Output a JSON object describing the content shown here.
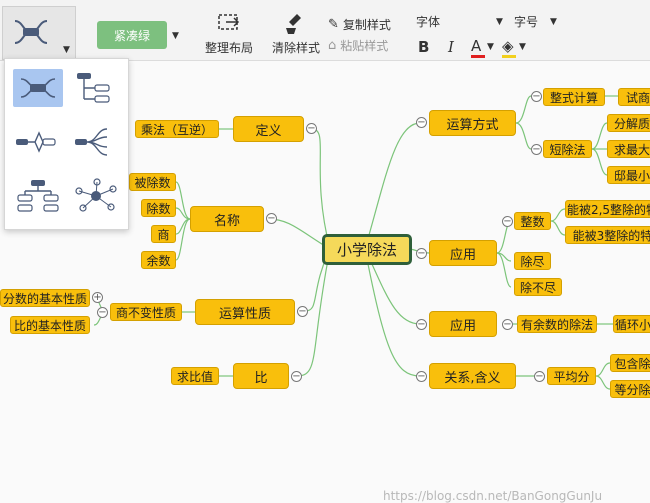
{
  "toolbar": {
    "organize_label": "整理布局",
    "clear_style_label": "清除样式",
    "copy_style_label": "复制样式",
    "paste_style_label": "粘贴样式",
    "theme_label": "紧凑绿",
    "font_label": "字体",
    "font_size_label": "字号",
    "bold_label": "B",
    "italic_label": "I",
    "font_color_label": "A"
  },
  "mindmap": {
    "root": "小学除法",
    "left": {
      "definition": "定义",
      "definition_child": "乘法（互逆）",
      "name": "名称",
      "name_children": [
        "被除数",
        "除数",
        "商",
        "余数"
      ],
      "property": "运算性质",
      "property_child": "商不变性质",
      "property_grandchildren": [
        "分数的基本性质",
        "比的基本性质"
      ],
      "ratio": "比",
      "ratio_child": "求比值"
    },
    "right": {
      "method": "运算方式",
      "method_children": [
        "整式计算",
        "短除法"
      ],
      "method_grand1": "试商",
      "method_grand2": [
        "分解质",
        "求最大",
        "邸最小"
      ],
      "apply1": "应用",
      "apply1_children": [
        "整数",
        "除尽",
        "除不尽"
      ],
      "apply1_grand": [
        "能被2,5整除的特",
        "能被3整除的特"
      ],
      "apply2": "应用",
      "apply2_child": "有余数的除法",
      "apply2_grand": "循环小",
      "relation": "关系,含义",
      "relation_child": "平均分",
      "relation_grand": [
        "包含除",
        "等分除"
      ]
    }
  },
  "watermark": "https://blog.csdn.net/BanGongGunJu",
  "colors": {
    "node": "#f9bf0c",
    "root_border": "#2f5f3a",
    "line": "#7cc47a",
    "theme_button": "#7dc07f"
  }
}
